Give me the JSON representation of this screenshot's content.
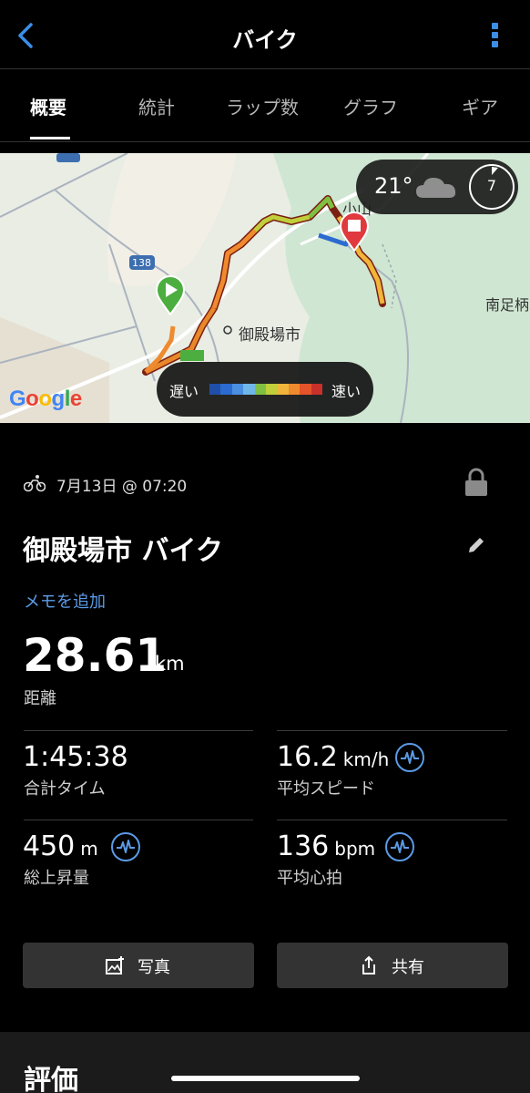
{
  "header": {
    "title": "バイク",
    "back_icon": "chevron-left-icon",
    "more_icon": "more-vertical-icon",
    "accent": "#3b8ee6"
  },
  "tabs": [
    {
      "label": "概要",
      "active": true
    },
    {
      "label": "統計"
    },
    {
      "label": "ラップ数"
    },
    {
      "label": "グラフ"
    },
    {
      "label": "ギア"
    }
  ],
  "map": {
    "city_label": "御殿場市",
    "city_label2": "南足柄",
    "oyama_label": "小山",
    "road_label_1": "138",
    "road_label_2": "138",
    "google_logo": "Google",
    "weather": {
      "temp": "21°",
      "wind": "7",
      "icon": "cloud-icon"
    },
    "legend": {
      "slow": "遅い",
      "fast": "速い",
      "colors": [
        "#1f4fa8",
        "#2c6bd0",
        "#4a8fe0",
        "#6fb7e8",
        "#7fc041",
        "#c0cf3a",
        "#f0b53a",
        "#ef8a2e",
        "#e5532a",
        "#c8302a"
      ]
    },
    "start_color": "#4cae3f",
    "end_color": "#e0393e"
  },
  "activity": {
    "date": "7月13日 @ 07:20",
    "name": "御殿場市 バイク",
    "memo": "メモを追加",
    "distance": "28.61",
    "distance_unit": "km",
    "distance_label": "距離"
  },
  "stats": {
    "time": {
      "value": "1:45:38",
      "label": "合計タイム"
    },
    "speed": {
      "value": "16.2",
      "unit": "km/h",
      "label": "平均スピード"
    },
    "ascent": {
      "value": "450",
      "unit": "m",
      "label": "総上昇量"
    },
    "hr": {
      "value": "136",
      "unit": "bpm",
      "label": "平均心拍"
    }
  },
  "actions": {
    "photo": "写真",
    "share": "共有"
  },
  "evaluation": {
    "title": "評価"
  }
}
